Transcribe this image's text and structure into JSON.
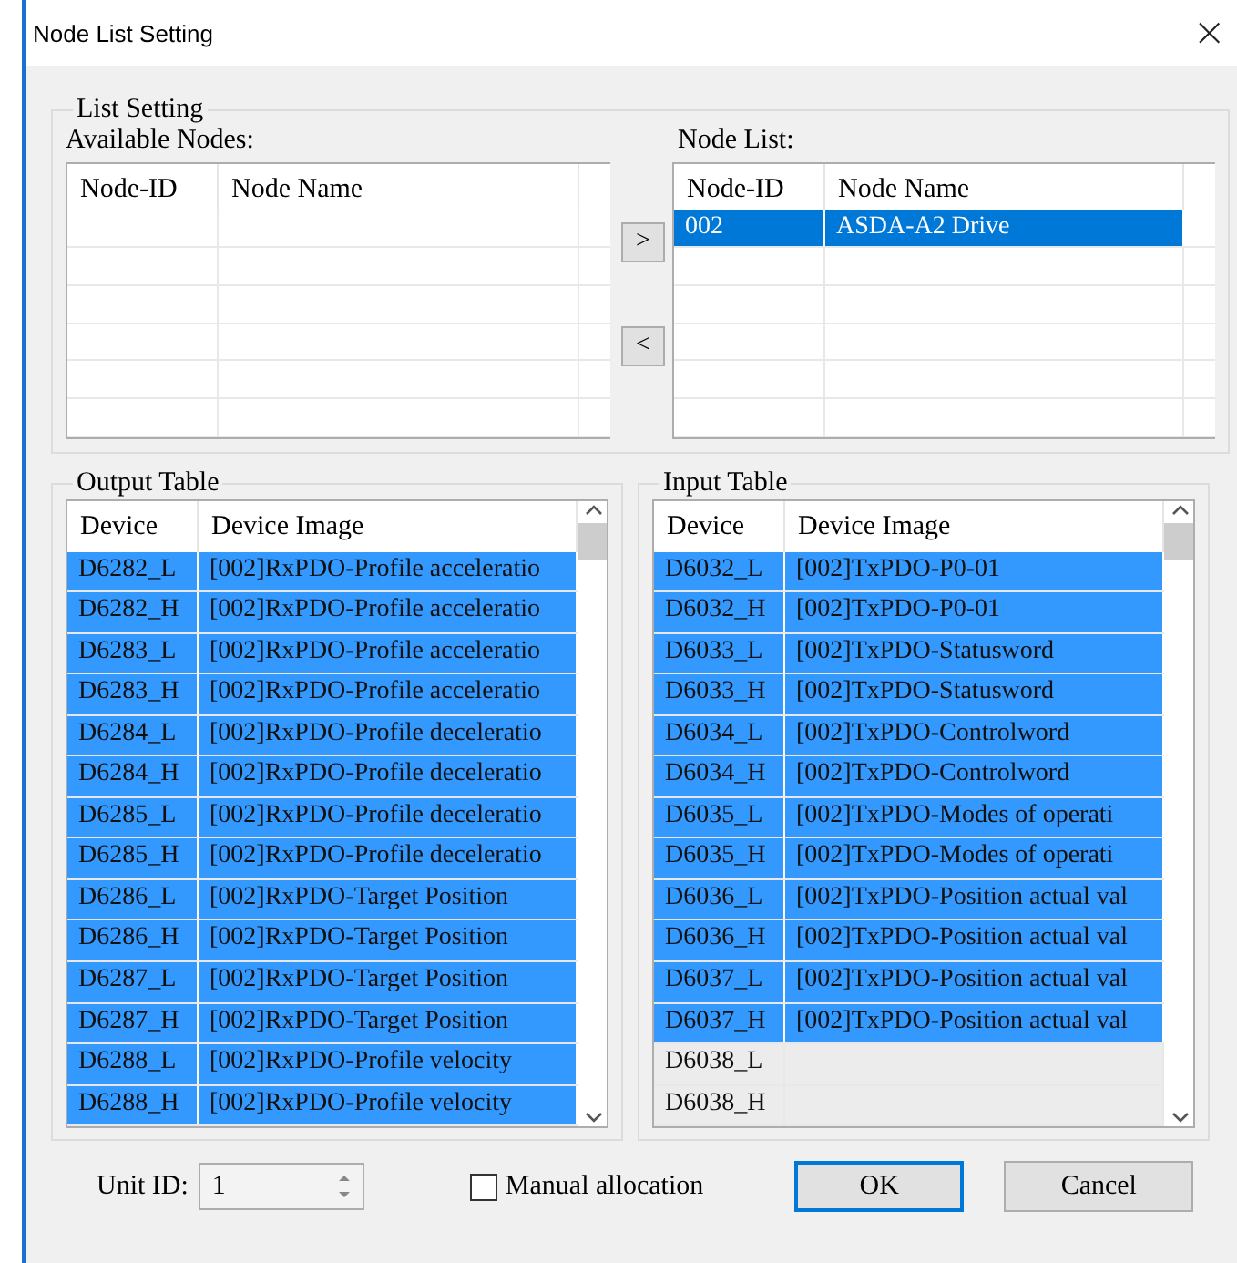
{
  "window": {
    "title": "Node List Setting",
    "close": "×"
  },
  "list_setting": {
    "title": "List Setting",
    "available_nodes": {
      "label": "Available Nodes:",
      "columns": [
        "Node-ID",
        "Node Name"
      ]
    },
    "move_buttons": [
      ">",
      "<"
    ],
    "node_list": {
      "label": "Node List:",
      "columns": [
        "Node-ID",
        "Node Name"
      ],
      "rows": [
        {
          "id": "002",
          "name": "ASDA-A2 Drive",
          "selected": true
        }
      ]
    }
  },
  "output_table": {
    "title": "Output Table",
    "columns": [
      "Device",
      "Device Image"
    ],
    "rows": [
      {
        "device": "D6282_L",
        "image": "[002]RxPDO-Profile acceleratio",
        "selected": true
      },
      {
        "device": "D6282_H",
        "image": "[002]RxPDO-Profile acceleratio",
        "selected": true
      },
      {
        "device": "D6283_L",
        "image": "[002]RxPDO-Profile acceleratio",
        "selected": true
      },
      {
        "device": "D6283_H",
        "image": "[002]RxPDO-Profile acceleratio",
        "selected": true
      },
      {
        "device": "D6284_L",
        "image": "[002]RxPDO-Profile deceleratio",
        "selected": true
      },
      {
        "device": "D6284_H",
        "image": "[002]RxPDO-Profile deceleratio",
        "selected": true
      },
      {
        "device": "D6285_L",
        "image": "[002]RxPDO-Profile deceleratio",
        "selected": true
      },
      {
        "device": "D6285_H",
        "image": "[002]RxPDO-Profile deceleratio",
        "selected": true
      },
      {
        "device": "D6286_L",
        "image": "[002]RxPDO-Target Position",
        "selected": true
      },
      {
        "device": "D6286_H",
        "image": "[002]RxPDO-Target Position",
        "selected": true
      },
      {
        "device": "D6287_L",
        "image": "[002]RxPDO-Target Position",
        "selected": true
      },
      {
        "device": "D6287_H",
        "image": "[002]RxPDO-Target Position",
        "selected": true
      },
      {
        "device": "D6288_L",
        "image": "[002]RxPDO-Profile velocity",
        "selected": true
      },
      {
        "device": "D6288_H",
        "image": "[002]RxPDO-Profile velocity",
        "selected": true
      }
    ]
  },
  "input_table": {
    "title": "Input Table",
    "columns": [
      "Device",
      "Device Image"
    ],
    "rows": [
      {
        "device": "D6032_L",
        "image": "[002]TxPDO-P0-01",
        "selected": true
      },
      {
        "device": "D6032_H",
        "image": "[002]TxPDO-P0-01",
        "selected": true
      },
      {
        "device": "D6033_L",
        "image": "[002]TxPDO-Statusword",
        "selected": true
      },
      {
        "device": "D6033_H",
        "image": "[002]TxPDO-Statusword",
        "selected": true
      },
      {
        "device": "D6034_L",
        "image": "[002]TxPDO-Controlword",
        "selected": true
      },
      {
        "device": "D6034_H",
        "image": "[002]TxPDO-Controlword",
        "selected": true
      },
      {
        "device": "D6035_L",
        "image": "[002]TxPDO-Modes of operati",
        "selected": true
      },
      {
        "device": "D6035_H",
        "image": "[002]TxPDO-Modes of operati",
        "selected": true
      },
      {
        "device": "D6036_L",
        "image": "[002]TxPDO-Position actual val",
        "selected": true
      },
      {
        "device": "D6036_H",
        "image": "[002]TxPDO-Position actual val",
        "selected": true
      },
      {
        "device": "D6037_L",
        "image": "[002]TxPDO-Position actual val",
        "selected": true
      },
      {
        "device": "D6037_H",
        "image": "[002]TxPDO-Position actual val",
        "selected": true
      },
      {
        "device": "D6038_L",
        "selected": false
      },
      {
        "device": "D6038_H",
        "selected": false
      }
    ]
  },
  "unit_id": {
    "label": "Unit ID:",
    "value": "1"
  },
  "manual_allocation": {
    "label": "Manual allocation",
    "checked": false
  },
  "buttons": [
    {
      "label": "OK",
      "default": true
    },
    {
      "label": "Cancel",
      "default": false
    }
  ]
}
